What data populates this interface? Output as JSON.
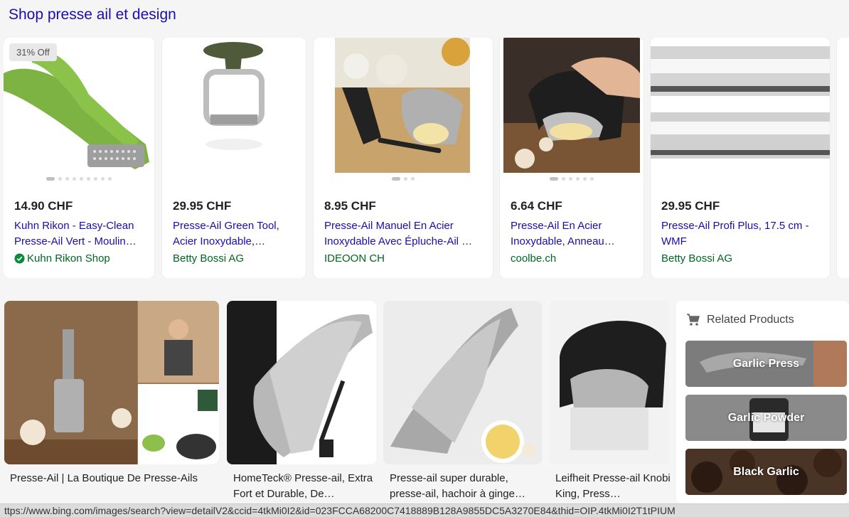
{
  "header": {
    "title": "Shop presse ail et design"
  },
  "products": [
    {
      "badge": "31% Off",
      "price": "14.90 CHF",
      "name": "Kuhn Rikon - Easy-Clean Presse-Ail Vert - Moulin…",
      "seller": "Kuhn Rikon Shop",
      "verified": true
    },
    {
      "price": "29.95 CHF",
      "name": "Presse-Ail Green Tool, Acier Inoxydable,…",
      "seller": "Betty Bossi AG"
    },
    {
      "price": "8.95 CHF",
      "name": "Presse-Ail Manuel En Acier Inoxydable Avec Épluche-Ail …",
      "seller": "IDEOON CH"
    },
    {
      "price": "6.64 CHF",
      "name": "Presse-Ail En Acier Inoxydable, Anneau…",
      "seller": "coolbe.ch"
    },
    {
      "price": "29.95 CHF",
      "name": "Presse-Ail Profi Plus, 17.5 cm - WMF",
      "seller": "Betty Bossi AG"
    }
  ],
  "images": [
    {
      "caption": "Presse-Ail | La Boutique De Presse-Ails"
    },
    {
      "caption": "HomeTeck® Presse-ail, Extra Fort et Durable, De…"
    },
    {
      "caption": "Presse-ail super durable, presse-ail, hachoir à ginge…"
    },
    {
      "caption": "Leifheit Presse-ail Knobi King, Press…"
    }
  ],
  "related": {
    "title": "Related Products",
    "items": [
      {
        "label": "Garlic Press"
      },
      {
        "label": "Garlic Powder"
      },
      {
        "label": "Black Garlic"
      }
    ]
  },
  "status_url": "ttps://www.bing.com/images/search?view=detailV2&ccid=4tkMi0I2&id=023FCCA68200C7418889B128A9855DC5A3270E84&thid=OIP.4tkMi0I2T1tPIUM",
  "colors": {
    "link": "#1a0dab",
    "seller": "#006621",
    "accent_green": "#0a8a3a"
  }
}
